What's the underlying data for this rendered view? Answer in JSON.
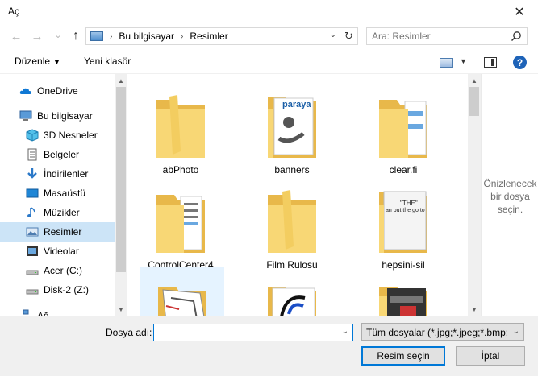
{
  "window": {
    "title": "Aç",
    "close_glyph": "✕"
  },
  "address": {
    "back_glyph": "←",
    "forward_glyph": "→",
    "recent_glyph": "⌄",
    "up_glyph": "↑",
    "crumbs": [
      "Bu bilgisayar",
      "Resimler"
    ],
    "separator": "›",
    "dropdown_glyph": "⌄",
    "refresh_glyph": "↻"
  },
  "search": {
    "placeholder": "Ara: Resimler"
  },
  "toolbar": {
    "organize_label": "Düzenle",
    "organize_caret": "▼",
    "new_folder_label": "Yeni klasör",
    "view_caret": "▼",
    "help_glyph": "?"
  },
  "nav": {
    "items": [
      {
        "label": "OneDrive",
        "icon": "cloud-icon"
      },
      {
        "label": "Bu bilgisayar",
        "icon": "computer-icon"
      },
      {
        "label": "3D Nesneler",
        "icon": "cube-icon"
      },
      {
        "label": "Belgeler",
        "icon": "document-icon"
      },
      {
        "label": "İndirilenler",
        "icon": "download-icon"
      },
      {
        "label": "Masaüstü",
        "icon": "desktop-icon"
      },
      {
        "label": "Müzikler",
        "icon": "music-icon"
      },
      {
        "label": "Resimler",
        "icon": "pictures-icon",
        "selected": true
      },
      {
        "label": "Videolar",
        "icon": "video-icon"
      },
      {
        "label": "Acer (C:)",
        "icon": "drive-icon"
      },
      {
        "label": "Disk-2 (Z:)",
        "icon": "drive-icon"
      },
      {
        "label": "Ağ",
        "icon": "network-icon"
      }
    ],
    "scroll_up_glyph": "▲",
    "scroll_down_glyph": "▼"
  },
  "files": [
    {
      "name": "abPhoto",
      "kind": "folder-icon"
    },
    {
      "name": "banners",
      "kind": "folder-icon",
      "preview_text": "paraya"
    },
    {
      "name": "clear.fi",
      "kind": "folder-icon"
    },
    {
      "name": "ControlCenter4",
      "kind": "folder-icon"
    },
    {
      "name": "Film Rulosu",
      "kind": "folder-icon"
    },
    {
      "name": "hepsini-sil",
      "kind": "folder-icon",
      "preview_text": "\"THE\"",
      "preview_text2": "an but the go to"
    },
    {
      "name": "",
      "kind": "folder-icon",
      "selected": true
    },
    {
      "name": "",
      "kind": "folder-icon"
    },
    {
      "name": "",
      "kind": "folder-icon"
    }
  ],
  "content_scroll": {
    "up_glyph": "▲",
    "down_glyph": "▼"
  },
  "preview": {
    "line1": "Önizlenecek",
    "line2": "bir dosya",
    "line3": "seçin."
  },
  "bottom": {
    "filename_label": "Dosya adı:",
    "filename_value": "",
    "dropdown_glyph": "⌄",
    "filetype_value": "Tüm dosyalar (*.jpg;*.jpeg;*.bmp;",
    "open_button": "Resim seçin",
    "cancel_button": "İptal"
  },
  "colors": {
    "accent": "#0078d7",
    "selection": "#cce4f7",
    "folder": "#f8d775"
  }
}
